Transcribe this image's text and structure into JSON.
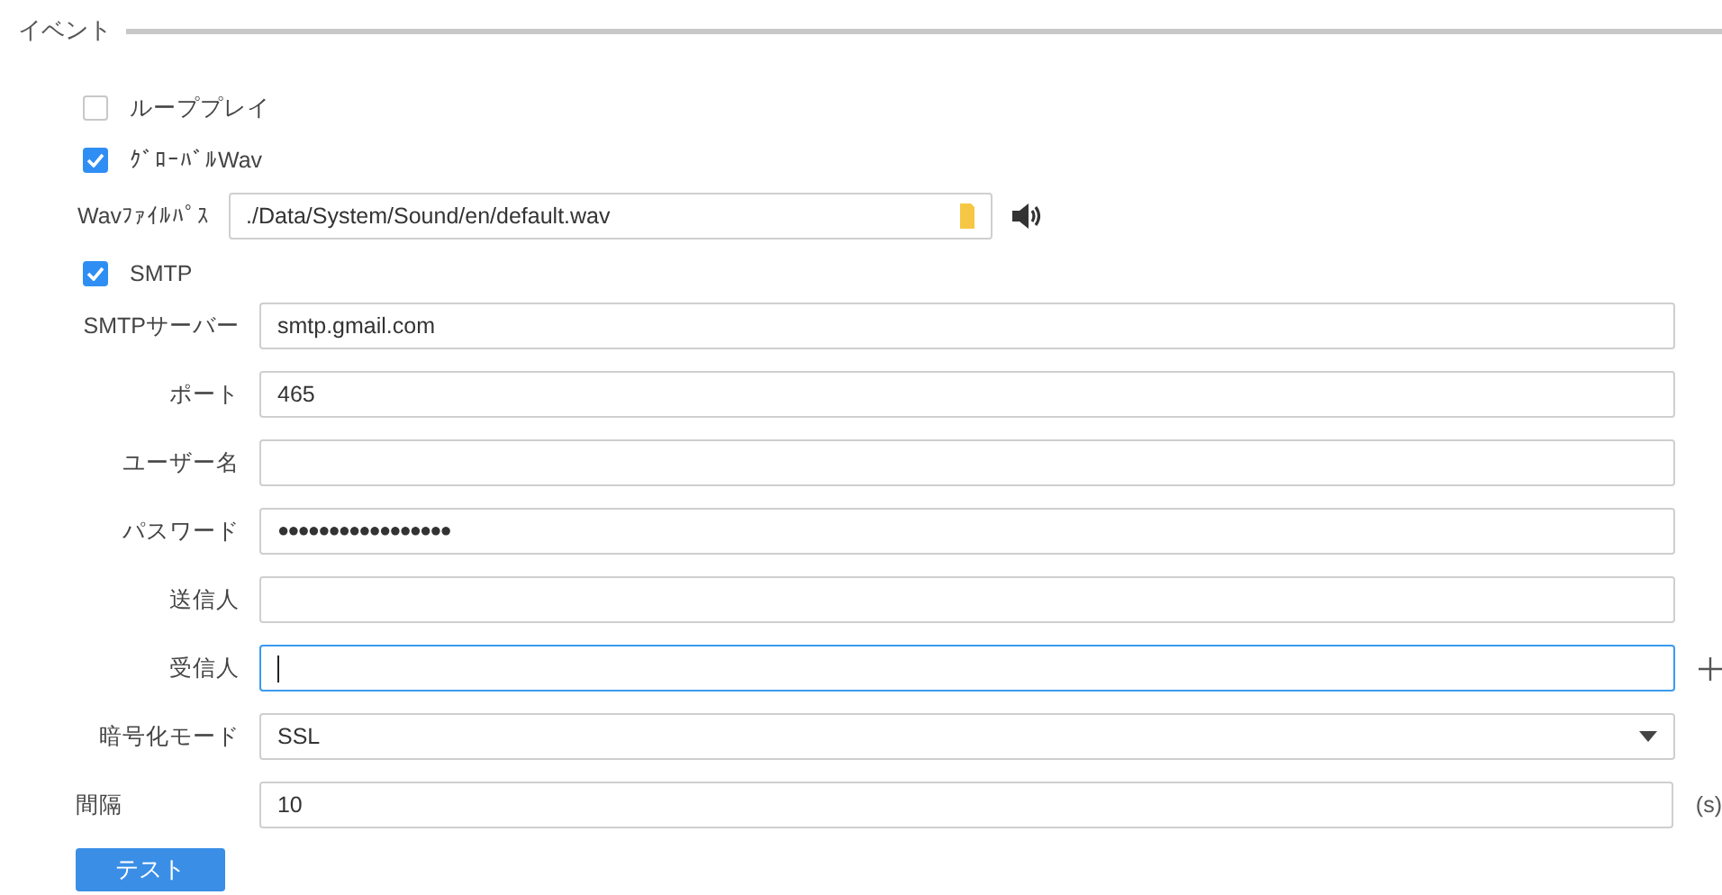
{
  "section": {
    "title": "イベント"
  },
  "options": [
    {
      "label": "ループプレイ",
      "checked": false
    },
    {
      "label": "ｸﾞﾛｰﾊﾞﾙWav",
      "checked": true
    }
  ],
  "wav_path": {
    "label": "Wavﾌｧｲﾙﾊﾟｽ",
    "value": "./Data/System/Sound/en/default.wav"
  },
  "smtp": {
    "label": "SMTP",
    "checked": true
  },
  "fields": [
    {
      "kind": "text",
      "label": "SMTPサーバー",
      "value": "smtp.gmail.com",
      "focused": false
    },
    {
      "kind": "text",
      "label": "ポート",
      "value": "465",
      "focused": false
    },
    {
      "kind": "text",
      "label": "ユーザー名",
      "focused": false
    },
    {
      "kind": "password",
      "label": "パスワード",
      "value": "●●●●●●●●●●●●●●●●●",
      "focused": false
    },
    {
      "kind": "text",
      "label": "送信人",
      "focused": false
    },
    {
      "kind": "add",
      "label": "受信人",
      "focused": true
    },
    {
      "kind": "select",
      "label": "暗号化モード",
      "value": "SSL",
      "focused": false
    },
    {
      "kind": "unit",
      "label": "間隔",
      "value": "10",
      "unit": "(s)",
      "focused": false
    }
  ],
  "test_button": {
    "label": "テスト"
  }
}
